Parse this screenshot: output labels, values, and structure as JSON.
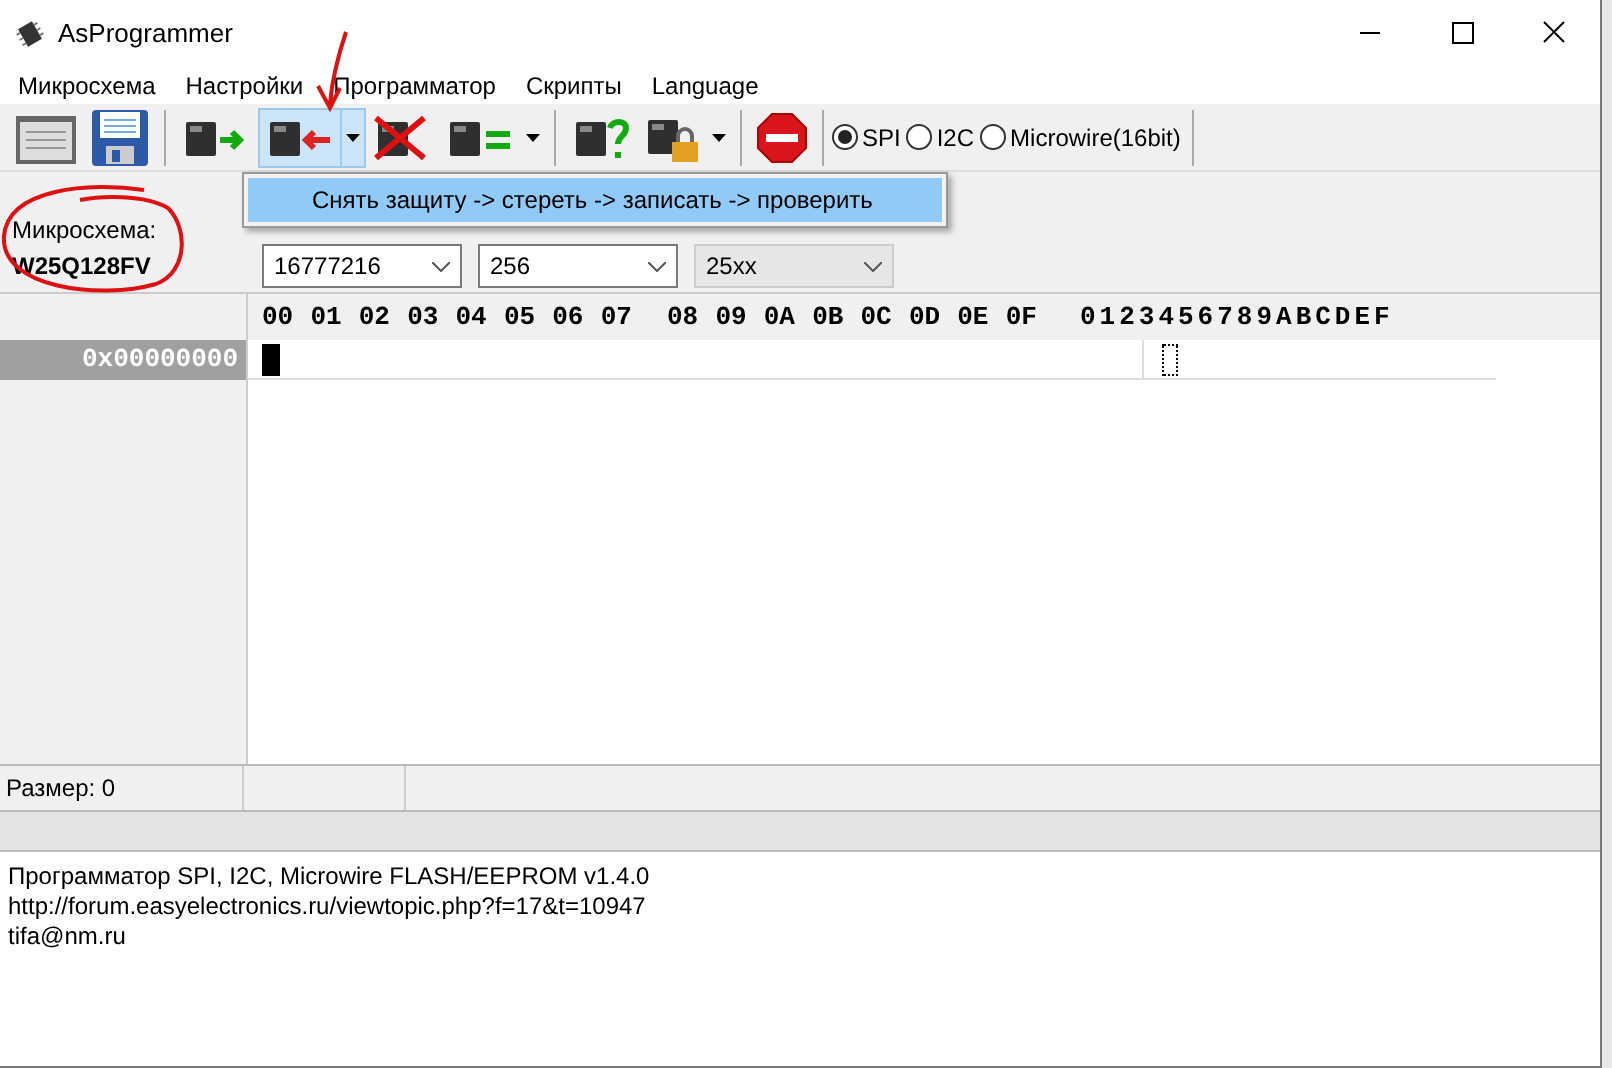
{
  "window": {
    "title": "AsProgrammer"
  },
  "menu": [
    "Микросхема",
    "Настройки",
    "Программатор",
    "Скрипты",
    "Language"
  ],
  "toolbar_buttons": [
    {
      "kind": "open",
      "pressed": false
    },
    {
      "kind": "save",
      "pressed": false
    },
    {
      "kind": "read",
      "pressed": false
    },
    {
      "kind": "write",
      "pressed": true
    },
    {
      "kind": "erase",
      "pressed": false
    },
    {
      "kind": "verify",
      "pressed": false
    },
    {
      "kind": "check",
      "pressed": false
    },
    {
      "kind": "lock",
      "pressed": false
    },
    {
      "kind": "stop",
      "pressed": false
    }
  ],
  "interfaces": [
    {
      "label": "SPI",
      "selected": true
    },
    {
      "label": "I2C",
      "selected": false
    },
    {
      "label": "Microwire(16bit)",
      "selected": false
    }
  ],
  "dropdown_menu": {
    "items": [
      {
        "label": "Снять защиту -> стереть -> записать -> проверить",
        "highlighted": true
      }
    ]
  },
  "chip": {
    "label": "Микросхема:",
    "name": "W25Q128FV"
  },
  "fields": [
    {
      "value": "16777216",
      "disabled": false
    },
    {
      "value": "256",
      "disabled": false
    },
    {
      "value": "25xx",
      "disabled": true
    }
  ],
  "hex": {
    "columns": [
      "00",
      "01",
      "02",
      "03",
      "04",
      "05",
      "06",
      "07",
      "08",
      "09",
      "0A",
      "0B",
      "0C",
      "0D",
      "0E",
      "0F"
    ],
    "ascii_header": "0123456789ABCDEF",
    "rows": [
      {
        "address": "0x00000000"
      }
    ]
  },
  "status_bar": [
    "Размер: 0"
  ],
  "log": [
    "Программатор SPI, I2C, Microwire FLASH/EEPROM v1.4.0",
    "http://forum.easyelectronics.ru/viewtopic.php?f=17&t=10947",
    "tifa@nm.ru"
  ]
}
